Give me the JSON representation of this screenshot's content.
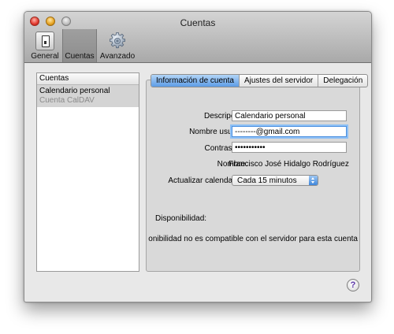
{
  "window": {
    "title": "Cuentas"
  },
  "toolbar": {
    "items": [
      {
        "label": "General",
        "icon": "light-switch-icon"
      },
      {
        "label": "Cuentas",
        "icon": "accounts-icon",
        "selected": true
      },
      {
        "label": "Avanzado",
        "icon": "gear-icon"
      }
    ]
  },
  "accounts": {
    "header": "Cuentas",
    "items": [
      {
        "name": "Calendario personal",
        "type": "Cuenta CalDAV",
        "selected": true
      }
    ]
  },
  "tabs": [
    {
      "label": "Información de cuenta",
      "active": true
    },
    {
      "label": "Ajustes del servidor"
    },
    {
      "label": "Delegación"
    }
  ],
  "form": {
    "description": {
      "label": "Descripción:",
      "value": "Calendario personal"
    },
    "username": {
      "label": "Nombre usuario:",
      "value": "--------@gmail.com"
    },
    "password": {
      "label": "Contraseña:",
      "value": "•••••••••••"
    },
    "name": {
      "label": "Nombre:",
      "value": "Francisco José Hidalgo Rodríguez"
    },
    "refresh": {
      "label": "Actualizar calendarios:",
      "value": "Cada 15 minutos"
    }
  },
  "availability": {
    "label": "Disponibilidad:",
    "message": "La disponibilidad no es compatible con el servidor para esta cuenta"
  },
  "help": {
    "label": "?"
  },
  "colors": {
    "accent": "#5d9ce6",
    "focus_ring": "#8ec0f5",
    "selection": "#d4d4d4",
    "help_glyph": "#5b35a8"
  }
}
